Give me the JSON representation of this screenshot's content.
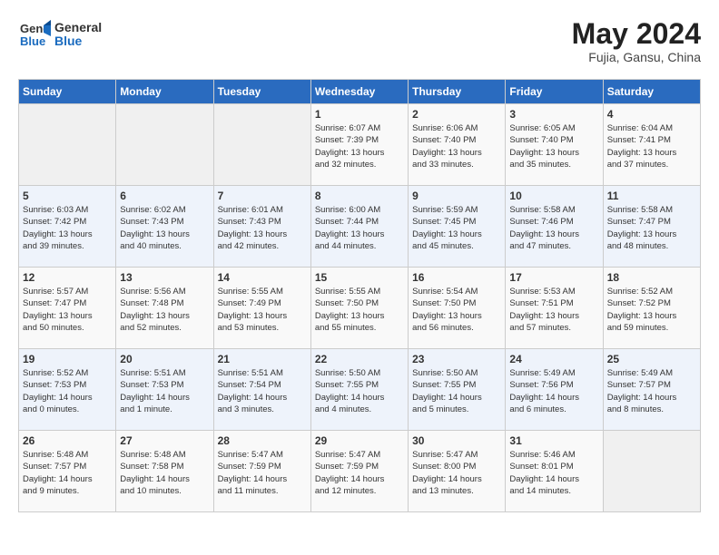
{
  "header": {
    "logo_general": "General",
    "logo_blue": "Blue",
    "month_year": "May 2024",
    "location": "Fujia, Gansu, China"
  },
  "days_of_week": [
    "Sunday",
    "Monday",
    "Tuesday",
    "Wednesday",
    "Thursday",
    "Friday",
    "Saturday"
  ],
  "weeks": [
    [
      {
        "day": "",
        "content": ""
      },
      {
        "day": "",
        "content": ""
      },
      {
        "day": "",
        "content": ""
      },
      {
        "day": "1",
        "content": "Sunrise: 6:07 AM\nSunset: 7:39 PM\nDaylight: 13 hours\nand 32 minutes."
      },
      {
        "day": "2",
        "content": "Sunrise: 6:06 AM\nSunset: 7:40 PM\nDaylight: 13 hours\nand 33 minutes."
      },
      {
        "day": "3",
        "content": "Sunrise: 6:05 AM\nSunset: 7:40 PM\nDaylight: 13 hours\nand 35 minutes."
      },
      {
        "day": "4",
        "content": "Sunrise: 6:04 AM\nSunset: 7:41 PM\nDaylight: 13 hours\nand 37 minutes."
      }
    ],
    [
      {
        "day": "5",
        "content": "Sunrise: 6:03 AM\nSunset: 7:42 PM\nDaylight: 13 hours\nand 39 minutes."
      },
      {
        "day": "6",
        "content": "Sunrise: 6:02 AM\nSunset: 7:43 PM\nDaylight: 13 hours\nand 40 minutes."
      },
      {
        "day": "7",
        "content": "Sunrise: 6:01 AM\nSunset: 7:43 PM\nDaylight: 13 hours\nand 42 minutes."
      },
      {
        "day": "8",
        "content": "Sunrise: 6:00 AM\nSunset: 7:44 PM\nDaylight: 13 hours\nand 44 minutes."
      },
      {
        "day": "9",
        "content": "Sunrise: 5:59 AM\nSunset: 7:45 PM\nDaylight: 13 hours\nand 45 minutes."
      },
      {
        "day": "10",
        "content": "Sunrise: 5:58 AM\nSunset: 7:46 PM\nDaylight: 13 hours\nand 47 minutes."
      },
      {
        "day": "11",
        "content": "Sunrise: 5:58 AM\nSunset: 7:47 PM\nDaylight: 13 hours\nand 48 minutes."
      }
    ],
    [
      {
        "day": "12",
        "content": "Sunrise: 5:57 AM\nSunset: 7:47 PM\nDaylight: 13 hours\nand 50 minutes."
      },
      {
        "day": "13",
        "content": "Sunrise: 5:56 AM\nSunset: 7:48 PM\nDaylight: 13 hours\nand 52 minutes."
      },
      {
        "day": "14",
        "content": "Sunrise: 5:55 AM\nSunset: 7:49 PM\nDaylight: 13 hours\nand 53 minutes."
      },
      {
        "day": "15",
        "content": "Sunrise: 5:55 AM\nSunset: 7:50 PM\nDaylight: 13 hours\nand 55 minutes."
      },
      {
        "day": "16",
        "content": "Sunrise: 5:54 AM\nSunset: 7:50 PM\nDaylight: 13 hours\nand 56 minutes."
      },
      {
        "day": "17",
        "content": "Sunrise: 5:53 AM\nSunset: 7:51 PM\nDaylight: 13 hours\nand 57 minutes."
      },
      {
        "day": "18",
        "content": "Sunrise: 5:52 AM\nSunset: 7:52 PM\nDaylight: 13 hours\nand 59 minutes."
      }
    ],
    [
      {
        "day": "19",
        "content": "Sunrise: 5:52 AM\nSunset: 7:53 PM\nDaylight: 14 hours\nand 0 minutes."
      },
      {
        "day": "20",
        "content": "Sunrise: 5:51 AM\nSunset: 7:53 PM\nDaylight: 14 hours\nand 1 minute."
      },
      {
        "day": "21",
        "content": "Sunrise: 5:51 AM\nSunset: 7:54 PM\nDaylight: 14 hours\nand 3 minutes."
      },
      {
        "day": "22",
        "content": "Sunrise: 5:50 AM\nSunset: 7:55 PM\nDaylight: 14 hours\nand 4 minutes."
      },
      {
        "day": "23",
        "content": "Sunrise: 5:50 AM\nSunset: 7:55 PM\nDaylight: 14 hours\nand 5 minutes."
      },
      {
        "day": "24",
        "content": "Sunrise: 5:49 AM\nSunset: 7:56 PM\nDaylight: 14 hours\nand 6 minutes."
      },
      {
        "day": "25",
        "content": "Sunrise: 5:49 AM\nSunset: 7:57 PM\nDaylight: 14 hours\nand 8 minutes."
      }
    ],
    [
      {
        "day": "26",
        "content": "Sunrise: 5:48 AM\nSunset: 7:57 PM\nDaylight: 14 hours\nand 9 minutes."
      },
      {
        "day": "27",
        "content": "Sunrise: 5:48 AM\nSunset: 7:58 PM\nDaylight: 14 hours\nand 10 minutes."
      },
      {
        "day": "28",
        "content": "Sunrise: 5:47 AM\nSunset: 7:59 PM\nDaylight: 14 hours\nand 11 minutes."
      },
      {
        "day": "29",
        "content": "Sunrise: 5:47 AM\nSunset: 7:59 PM\nDaylight: 14 hours\nand 12 minutes."
      },
      {
        "day": "30",
        "content": "Sunrise: 5:47 AM\nSunset: 8:00 PM\nDaylight: 14 hours\nand 13 minutes."
      },
      {
        "day": "31",
        "content": "Sunrise: 5:46 AM\nSunset: 8:01 PM\nDaylight: 14 hours\nand 14 minutes."
      },
      {
        "day": "",
        "content": ""
      }
    ]
  ]
}
